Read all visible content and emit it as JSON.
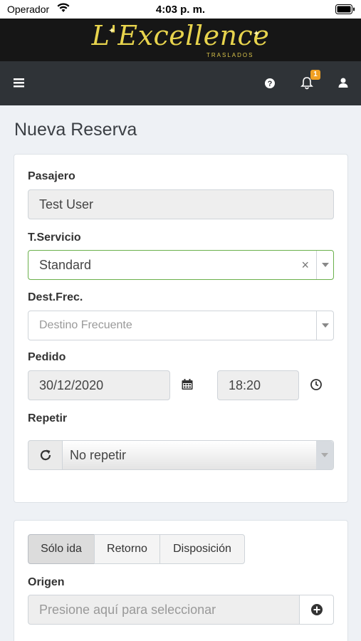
{
  "status_bar": {
    "carrier": "Operador",
    "time": "4:03 p. m."
  },
  "brand": {
    "logo_text": "L'Excellence",
    "logo_subtitle": "TRASLADOS"
  },
  "navbar": {
    "notification_count": "1"
  },
  "page": {
    "title": "Nueva Reserva"
  },
  "form": {
    "pasajero_label": "Pasajero",
    "pasajero_value": "Test User",
    "servicio_label": "T.Servicio",
    "servicio_value": "Standard",
    "dest_label": "Dest.Frec.",
    "dest_placeholder": "Destino Frecuente",
    "pedido_label": "Pedido",
    "pedido_date": "30/12/2020",
    "pedido_time": "18:20",
    "repetir_label": "Repetir",
    "repetir_value": "No repetir"
  },
  "trip": {
    "tabs": [
      "Sólo ida",
      "Retorno",
      "Disposición"
    ],
    "active_tab": "Sólo ida",
    "origen_label": "Origen",
    "origen_placeholder": "Presione aquí para seleccionar"
  },
  "colors": {
    "brand_gold": "#e8d44d",
    "navbar_bg": "#2f3337",
    "badge": "#f0a023",
    "focus_border": "#6ab04c"
  }
}
